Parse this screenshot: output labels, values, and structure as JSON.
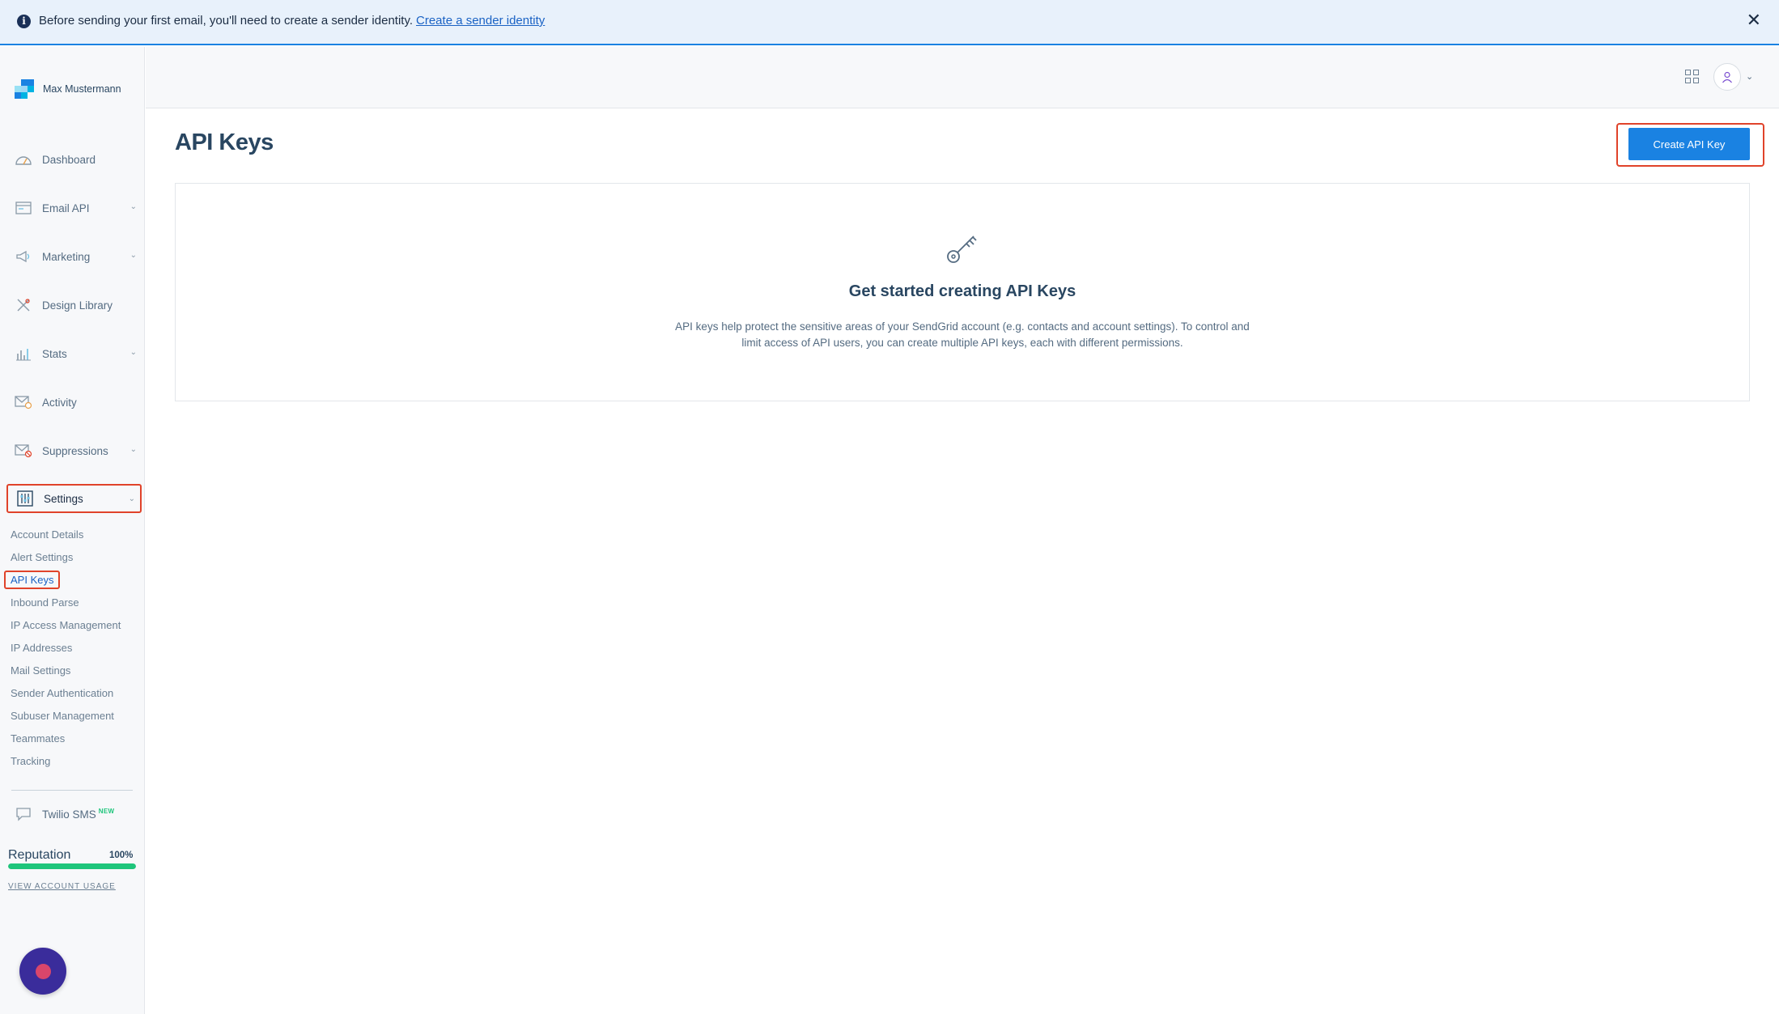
{
  "banner": {
    "message": "Before sending your first email, you'll need to create a sender identity.",
    "link": "Create a sender identity",
    "close_icon": "close-icon"
  },
  "brand": {
    "name": "Max Mustermann"
  },
  "nav": [
    {
      "label": "Dashboard",
      "icon": "gauge-icon",
      "has_chevron": false
    },
    {
      "label": "Email API",
      "icon": "envelope-window-icon",
      "has_chevron": true
    },
    {
      "label": "Marketing",
      "icon": "megaphone-icon",
      "has_chevron": true
    },
    {
      "label": "Design Library",
      "icon": "design-tools-icon",
      "has_chevron": false
    },
    {
      "label": "Stats",
      "icon": "bar-chart-icon",
      "has_chevron": true
    },
    {
      "label": "Activity",
      "icon": "mail-activity-icon",
      "has_chevron": false
    },
    {
      "label": "Suppressions",
      "icon": "mail-blocked-icon",
      "has_chevron": true
    },
    {
      "label": "Settings",
      "icon": "sliders-icon",
      "has_chevron": true
    }
  ],
  "settings_sub": [
    "Account Details",
    "Alert Settings",
    "API Keys",
    "Inbound Parse",
    "IP Access Management",
    "IP Addresses",
    "Mail Settings",
    "Sender Authentication",
    "Subuser Management",
    "Teammates",
    "Tracking"
  ],
  "twilio_sms": {
    "label": "Twilio SMS",
    "badge": "NEW"
  },
  "reputation": {
    "label": "Reputation",
    "percent_label": "100%",
    "value": 1.0,
    "bar_color": "#1ec57b"
  },
  "account_usage_link": "VIEW ACCOUNT USAGE",
  "main": {
    "title": "API Keys",
    "create_button": "Create API Key",
    "empty_title": "Get started creating API Keys",
    "empty_body": "API keys help protect the sensitive areas of your SendGrid account (e.g. contacts and account settings). To control and limit access of API users, you can create multiple API keys, each with different permissions."
  },
  "colors": {
    "accent": "#1a82e2",
    "highlight": "#e0432a",
    "text": "#294661"
  }
}
